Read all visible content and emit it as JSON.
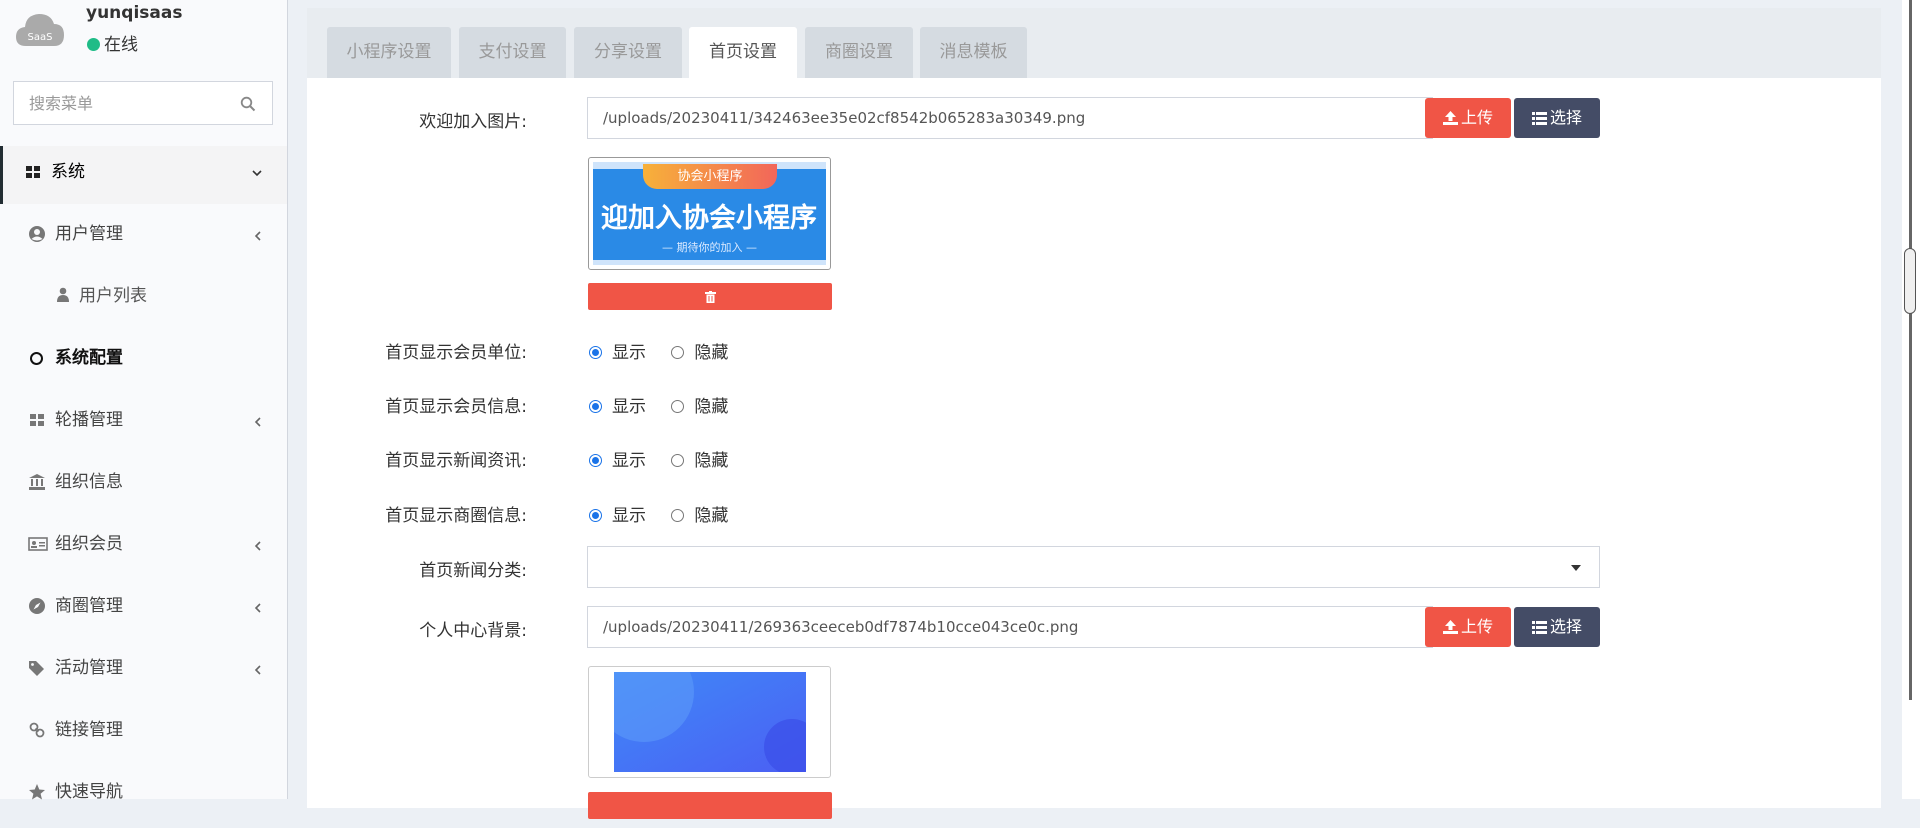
{
  "user": {
    "name": "yunqisaas",
    "status": "在线",
    "avatar_text": "SaaS"
  },
  "search": {
    "placeholder": "搜索菜单"
  },
  "menu": [
    {
      "label": "系统",
      "icon": "grid-icon",
      "expanded": true
    },
    {
      "label": "用户管理",
      "icon": "user-circle-icon"
    },
    {
      "label": "用户列表",
      "icon": "user-icon"
    },
    {
      "label": "系统配置",
      "icon": "circle-icon"
    },
    {
      "label": "轮播管理",
      "icon": "grid-icon"
    },
    {
      "label": "组织信息",
      "icon": "bank-icon"
    },
    {
      "label": "组织会员",
      "icon": "id-card-icon"
    },
    {
      "label": "商圈管理",
      "icon": "compass-icon"
    },
    {
      "label": "活动管理",
      "icon": "tags-icon"
    },
    {
      "label": "链接管理",
      "icon": "link-icon"
    },
    {
      "label": "快速导航",
      "icon": "star-icon"
    }
  ],
  "tabs": [
    "小程序设置",
    "支付设置",
    "分享设置",
    "首页设置",
    "商圈设置",
    "消息模板"
  ],
  "active_tab": "首页设置",
  "form": {
    "welcome_image": {
      "label": "欢迎加入图片:",
      "value": "/uploads/20230411/342463ee35e02cf8542b065283a30349.png",
      "preview_badge": "协会小程序",
      "preview_title": "迎加入协会小程序",
      "preview_sub": "— 期待你的加入 —"
    },
    "upload_label": "上传",
    "choose_label": "选择",
    "radios": [
      {
        "label": "首页显示会员单位:",
        "selected": "显示"
      },
      {
        "label": "首页显示会员信息:",
        "selected": "显示"
      },
      {
        "label": "首页显示新闻资讯:",
        "selected": "显示"
      },
      {
        "label": "首页显示商圈信息:",
        "selected": "显示"
      }
    ],
    "option_show": "显示",
    "option_hide": "隐藏",
    "news_category": {
      "label": "首页新闻分类:",
      "value": ""
    },
    "profile_bg": {
      "label": "个人中心背景:",
      "value": "/uploads/20230411/269363ceeceb0df7874b10cce043ce0c.png"
    }
  },
  "colors": {
    "danger": "#f05546",
    "dark_button": "#444c66",
    "online": "#1fbc87",
    "radio": "#1a73e8"
  }
}
